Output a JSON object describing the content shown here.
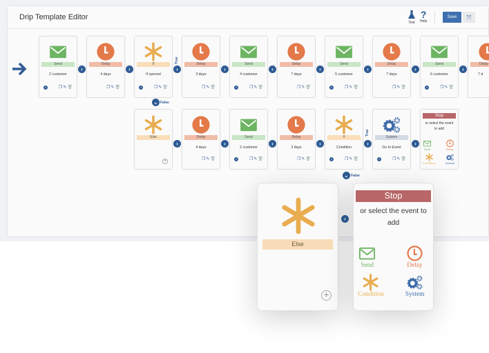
{
  "header": {
    "title": "Drip Template Editor",
    "test_label": "Test",
    "help_label": "Help",
    "save_label": "Save"
  },
  "colors": {
    "send": "#6db563",
    "delay": "#e4794a",
    "condition": "#e9ac4f",
    "system": "#3d6aa8",
    "stop": "#b86667",
    "accent": "#3f6fae"
  },
  "row1": [
    {
      "type": "send",
      "label": "Send",
      "text": "2 customer"
    },
    {
      "type": "delay",
      "label": "Delay",
      "text": "4 days"
    },
    {
      "type": "if",
      "label": "If",
      "text": "If opened"
    },
    {
      "type": "delay",
      "label": "Delay",
      "text": "3 days"
    },
    {
      "type": "send",
      "label": "Send",
      "text": "4 customer"
    },
    {
      "type": "delay",
      "label": "Delay",
      "text": "7 days"
    },
    {
      "type": "send",
      "label": "Send",
      "text": "5 customer"
    },
    {
      "type": "delay",
      "label": "Delay",
      "text": "7 days"
    },
    {
      "type": "send",
      "label": "Send",
      "text": "6 customer"
    },
    {
      "type": "delay",
      "label": "Delay",
      "text": "7 d"
    }
  ],
  "row2": [
    {
      "type": "else",
      "label": "Else",
      "text": ""
    },
    {
      "type": "delay",
      "label": "Delay",
      "text": "4 days"
    },
    {
      "type": "send",
      "label": "Send",
      "text": "2 customer"
    },
    {
      "type": "delay",
      "label": "Delay",
      "text": "3 days"
    },
    {
      "type": "if",
      "label": "If",
      "text": "Condition"
    },
    {
      "type": "system",
      "label": "System",
      "text": "Go to Event"
    }
  ],
  "branch": {
    "true_label": "True",
    "false_label": "False"
  },
  "stop_card": {
    "stop_label": "Stop",
    "prompt": "or select the event to add",
    "options": [
      "Send",
      "Delay",
      "Condition",
      "System"
    ]
  }
}
